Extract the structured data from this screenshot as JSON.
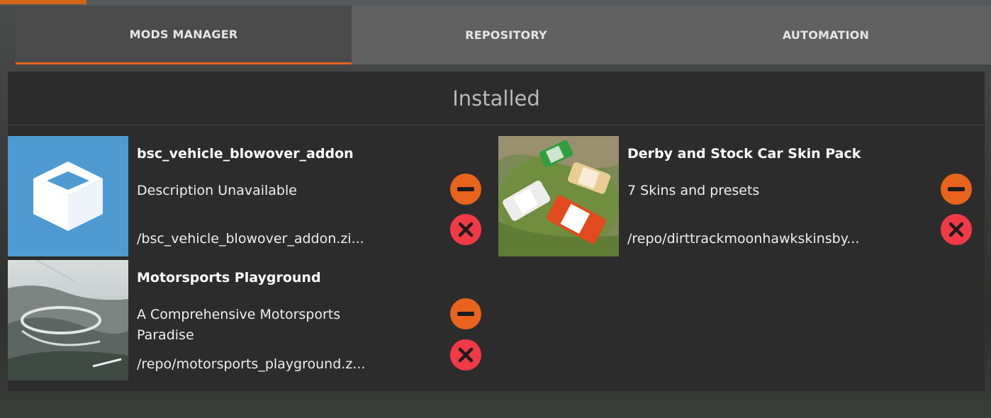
{
  "tabs": [
    {
      "label": "MODS MANAGER",
      "active": true
    },
    {
      "label": "REPOSITORY",
      "active": false
    },
    {
      "label": "AUTOMATION",
      "active": false
    }
  ],
  "panel": {
    "title": "Installed"
  },
  "mods": [
    {
      "name": "bsc_vehicle_blowover_addon",
      "description": "Description Unavailable",
      "path": "/bsc_vehicle_blowover_addon.zi..."
    },
    {
      "name": "Derby and Stock Car Skin Pack",
      "description": "7 Skins and presets",
      "path": "/repo/dirttrackmoonhawkskinsby..."
    },
    {
      "name": "Motorsports Playground",
      "description": "A Comprehensive Motorsports Paradise",
      "path": "/repo/motorsports_playground.z..."
    }
  ],
  "icons": {
    "disable": "minus-icon",
    "remove": "x-icon",
    "placeholder": "box-icon"
  },
  "colors": {
    "accent": "#e8641c",
    "disable_button": "#e8641c",
    "remove_button": "#f23a47",
    "placeholder_bg": "#4d9bd2"
  }
}
